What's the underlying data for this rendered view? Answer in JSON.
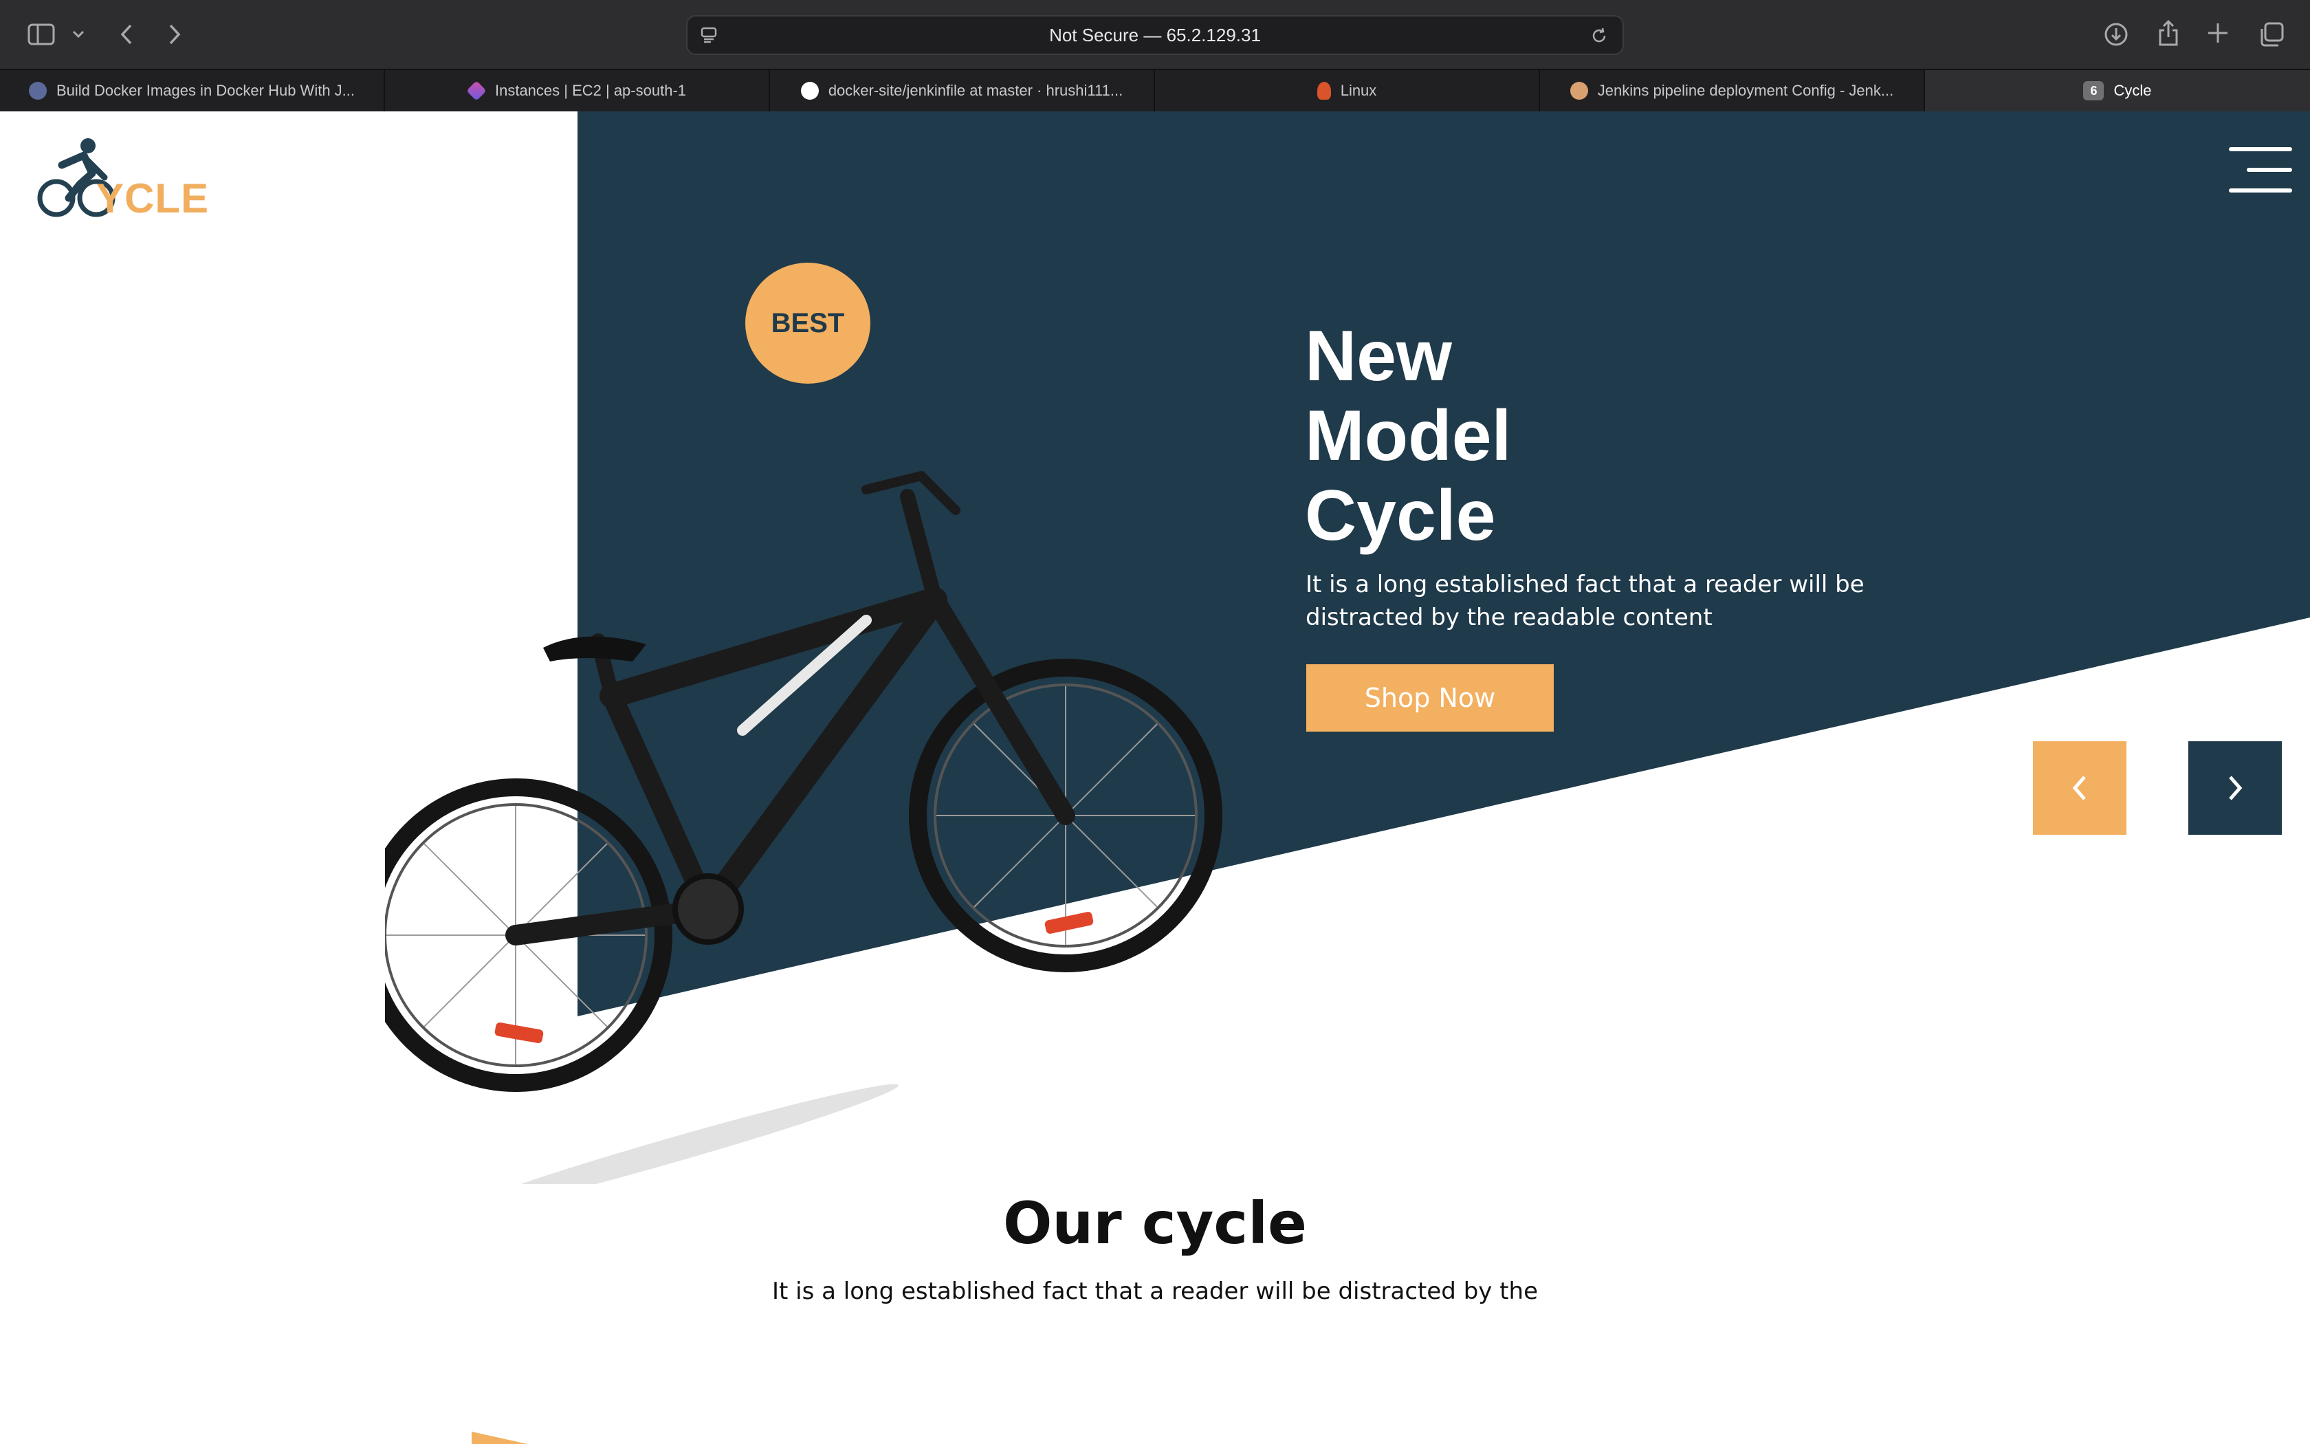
{
  "browser": {
    "address": "Not Secure — 65.2.129.31",
    "tabs": [
      {
        "label": "Build Docker Images in Docker Hub With J...",
        "favicon": "docker-hub-icon",
        "color": "#5b6a9a"
      },
      {
        "label": "Instances | EC2 | ap-south-1",
        "favicon": "aws-ec2-icon",
        "color": "#8a4fd8"
      },
      {
        "label": "docker-site/jenkinfile at master · hrushi111...",
        "favicon": "github-icon",
        "color": "#ffffff"
      },
      {
        "label": "Linux",
        "favicon": "linux-icon",
        "color": "#d9542b"
      },
      {
        "label": "Jenkins pipeline deployment Config - Jenk...",
        "favicon": "jenkins-icon",
        "color": "#d9a070"
      },
      {
        "label": "Cycle",
        "badge": "6",
        "active": true
      }
    ]
  },
  "site": {
    "logo_text": "YCLE",
    "hero": {
      "badge": "BEST",
      "title_lines": [
        "New",
        "Model",
        "Cycle"
      ],
      "description": "It is a long established fact that a reader will be distracted by the readable content",
      "cta": "Shop Now"
    },
    "section": {
      "title": "Our cycle",
      "description": "It is a long established fact that a reader will be distracted by the"
    },
    "colors": {
      "navy": "#1f3a4a",
      "orange": "#f3b060",
      "white": "#ffffff"
    }
  }
}
